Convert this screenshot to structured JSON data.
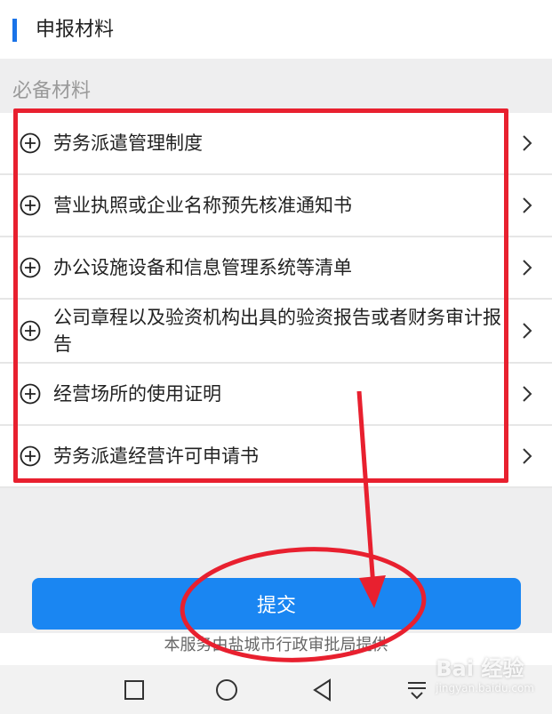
{
  "header": {
    "title": "申报材料"
  },
  "section": {
    "label": "必备材料"
  },
  "materials": [
    {
      "label": "劳务派遣管理制度"
    },
    {
      "label": "营业执照或企业名称预先核准通知书"
    },
    {
      "label": "办公设施设备和信息管理系统等清单"
    },
    {
      "label": "公司章程以及验资机构出具的验资报告或者财务审计报告"
    },
    {
      "label": "经营场所的使用证明"
    },
    {
      "label": "劳务派遣经营许可申请书"
    }
  ],
  "submit": {
    "label": "提交"
  },
  "footer": {
    "text": "本服务由盐城市行政审批局提供"
  },
  "watermark": {
    "brand": "Bai 经验",
    "url": "jingyan.baidu.com"
  },
  "colors": {
    "accent": "#1a86f2",
    "annotation": "#e8202f"
  },
  "icons": {
    "item": "plus-circle-icon",
    "chevron": "chevron-right-icon",
    "nav": [
      "square-icon",
      "circle-icon",
      "triangle-back-icon",
      "menu-down-icon"
    ]
  }
}
